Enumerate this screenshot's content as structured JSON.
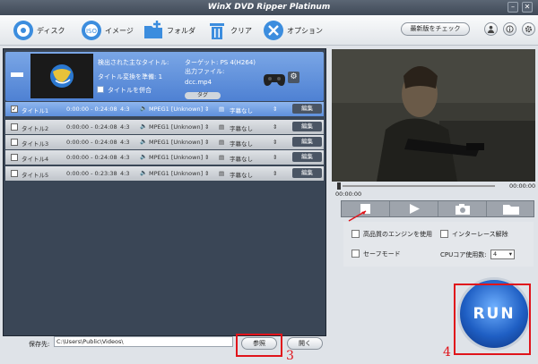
{
  "window": {
    "title": "WinX DVD Ripper Platinum",
    "min": "–",
    "close": "✕"
  },
  "toolbar": {
    "disc": "ディスク",
    "image": "イメージ",
    "folder": "フォルダ",
    "clear": "クリア",
    "options": "オプション",
    "update": "最新版をチェック",
    "info_icon": "info-icon",
    "gear_icon": "gear-icon"
  },
  "header": {
    "main_title": "検出された主なタイトル:",
    "main_title_value": "",
    "target": "ターゲット: PS 4(H264)",
    "ready": "タイトル変換を準備: 1",
    "output_label": "出力ファイル:",
    "output_file": "dcc.mp4",
    "merge": "タイトルを併合",
    "tag": "タグ"
  },
  "titles": [
    {
      "checked": true,
      "name": "タイトル1",
      "time": "0:00:00 - 0:24:08",
      "aspect": "4:3",
      "audio": "MPEG1 [Unknown]",
      "subtitle": "字幕なし",
      "edit": "編集"
    },
    {
      "checked": false,
      "name": "タイトル2",
      "time": "0:00:00 - 0:24:08",
      "aspect": "4:3",
      "audio": "MPEG1 [Unknown]",
      "subtitle": "字幕なし",
      "edit": "編集"
    },
    {
      "checked": false,
      "name": "タイトル3",
      "time": "0:00:00 - 0:24:08",
      "aspect": "4:3",
      "audio": "MPEG1 [Unknown]",
      "subtitle": "字幕なし",
      "edit": "編集"
    },
    {
      "checked": false,
      "name": "タイトル4",
      "time": "0:00:00 - 0:24:08",
      "aspect": "4:3",
      "audio": "MPEG1 [Unknown]",
      "subtitle": "字幕なし",
      "edit": "編集"
    },
    {
      "checked": false,
      "name": "タイトル5",
      "time": "0:00:00 - 0:23:38",
      "aspect": "4:3",
      "audio": "MPEG1 [Unknown]",
      "subtitle": "字幕なし",
      "edit": "編集"
    }
  ],
  "preview": {
    "time_start": "00:00:00",
    "time_end": "00:00:00"
  },
  "options": {
    "hq_engine": "高品質のエンジンを使用",
    "deinterlace": "インターレース解除",
    "safe_mode": "セーフモード",
    "cpu_label": "CPUコア使用数:",
    "cpu_value": "4"
  },
  "bottom": {
    "save_label": "保存先:",
    "save_path": "C:\\Users\\Public\\Videos\\",
    "browse": "参照",
    "open": "開く",
    "annot_3": "3",
    "annot_4": "4"
  },
  "run": {
    "label": "RUN"
  },
  "colors": {
    "accent": "#4e81d3",
    "annotation_red": "#e0141b",
    "run_blue": "#1f5fc4"
  }
}
